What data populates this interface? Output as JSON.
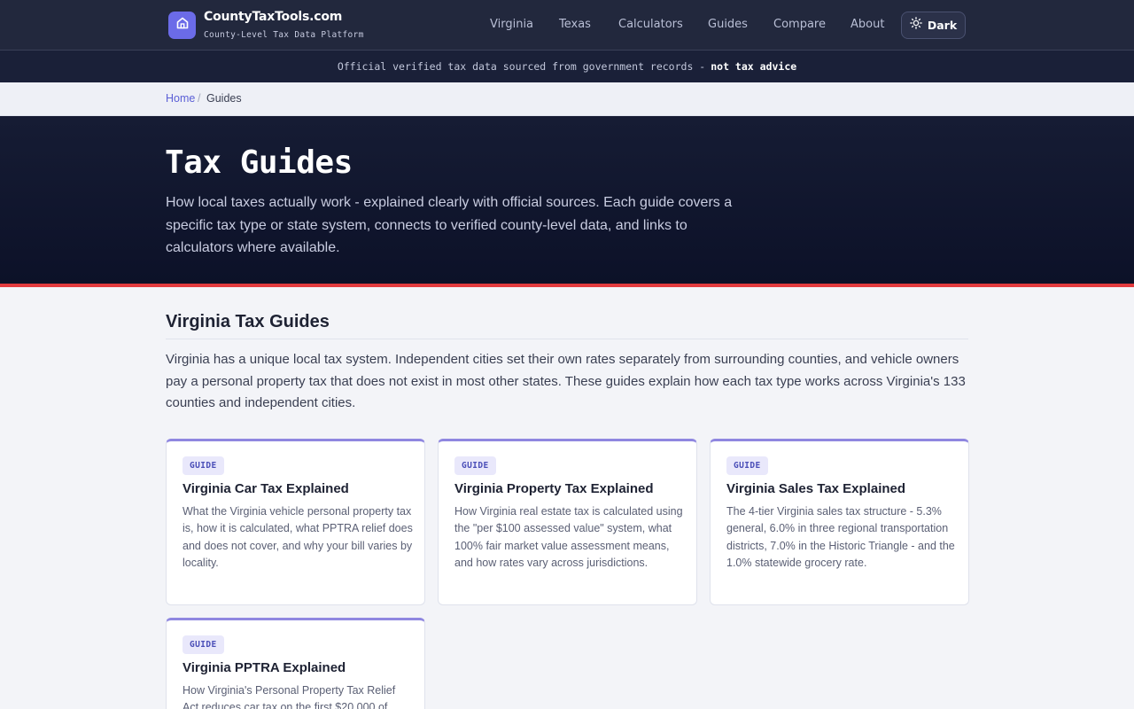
{
  "brand": {
    "name": "CountyTaxTools.com",
    "tagline": "County-Level Tax Data Platform",
    "icon": "home-icon"
  },
  "nav": {
    "items": [
      {
        "label": "Virginia"
      },
      {
        "label": "Texas"
      },
      {
        "label": "Calculators"
      },
      {
        "label": "Guides"
      },
      {
        "label": "Compare"
      },
      {
        "label": "About"
      }
    ],
    "theme_toggle": {
      "label": "Dark",
      "icon": "sun-icon"
    }
  },
  "notice": {
    "text": "Official verified tax data sourced from government records -",
    "emphasis": "not tax advice"
  },
  "breadcrumb": {
    "home": "Home",
    "separator": "/",
    "current": "Guides"
  },
  "hero": {
    "title": "Tax Guides",
    "description": "How local taxes actually work - explained clearly with official sources. Each guide covers a specific tax type or state system, connects to verified county-level data, and links to calculators where available."
  },
  "section": {
    "title": "Virginia Tax Guides",
    "description": "Virginia has a unique local tax system. Independent cities set their own rates separately from surrounding counties, and vehicle owners pay a personal property tax that does not exist in most other states. These guides explain how each tax type works across Virginia's 133 counties and independent cities."
  },
  "guides": [
    {
      "badge": "GUIDE",
      "title": "Virginia Car Tax Explained",
      "description": "What the Virginia vehicle personal property tax is, how it is calculated, what PPTRA relief does and does not cover, and why your bill varies by locality."
    },
    {
      "badge": "GUIDE",
      "title": "Virginia Property Tax Explained",
      "description": "How Virginia real estate tax is calculated using the \"per $100 assessed value\" system, what 100% fair market value assessment means, and how rates vary across jurisdictions."
    },
    {
      "badge": "GUIDE",
      "title": "Virginia Sales Tax Explained",
      "description": "The 4-tier Virginia sales tax structure - 5.3% general, 6.0% in three regional transportation districts, 7.0% in the Historic Triangle - and the 1.0% statewide grocery rate."
    },
    {
      "badge": "GUIDE",
      "title": "Virginia PPTRA Explained",
      "description": "How Virginia's Personal Property Tax Relief Act reduces car tax on the first $20,000 of"
    }
  ],
  "colors": {
    "header_bg": "#22283d",
    "hero_bg": "#0c1128",
    "accent_red": "#e23a3e",
    "brand_purple": "#6b6be8",
    "link_blue": "#5b5fd6"
  }
}
